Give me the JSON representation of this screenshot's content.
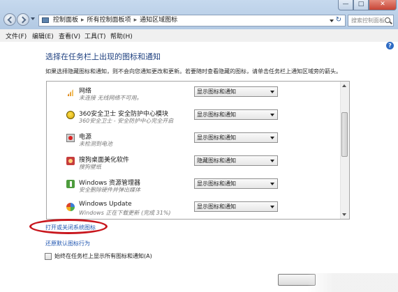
{
  "window": {
    "controls": {
      "minimize": "—",
      "maximize": "□",
      "close": "✕"
    }
  },
  "address": {
    "crumbs": [
      "控制面板",
      "所有控制面板项",
      "通知区域图标"
    ],
    "separator": "▸",
    "refresh": "↻"
  },
  "search": {
    "placeholder": "搜索控制面板"
  },
  "menu": {
    "items": [
      "文件(F)",
      "编辑(E)",
      "查看(V)",
      "工具(T)",
      "帮助(H)"
    ]
  },
  "help": {
    "label": "?"
  },
  "main": {
    "heading": "选择在任务栏上出现的图标和通知",
    "description": "如果选择隐藏图标和通知，则不会向您通知更改和更新。若要随时查看隐藏的图标，请单击任务栏上通知区域旁的箭头。"
  },
  "icons_list": [
    {
      "icon": "network-icon",
      "name": "网络",
      "status": "未连接 无线网络不可用。",
      "behavior": "显示图标和通知"
    },
    {
      "icon": "360-security-icon",
      "name": "360安全卫士 安全防护中心模块",
      "status": "360安全卫士 - 安全防护中心完全开启",
      "behavior": "显示图标和通知"
    },
    {
      "icon": "power-icon",
      "name": "电源",
      "status": "未检测到电池",
      "behavior": "显示图标和通知"
    },
    {
      "icon": "sogou-skin-icon",
      "name": "搜狗桌面美化软件",
      "status": "搜狗壁纸",
      "behavior": "隐藏图标和通知"
    },
    {
      "icon": "explorer-icon",
      "name": "Windows 资源管理器",
      "status": "安全删除硬件并弹出媒体",
      "behavior": "显示图标和通知"
    },
    {
      "icon": "windows-update-icon",
      "name": "Windows Update",
      "status": "Windows 正在下载更新 (完成 31%)",
      "behavior": "显示图标和通知"
    }
  ],
  "links": {
    "system_icons": "打开或关闭系统图标",
    "restore_defaults": "还原默认图标行为"
  },
  "always_show": {
    "label": "始终在任务栏上显示所有图标和通知(A)",
    "checked": false
  },
  "colors": {
    "heading": "#1d3f7f",
    "link": "#1f55b0",
    "highlight_oval": "#c8161d"
  }
}
